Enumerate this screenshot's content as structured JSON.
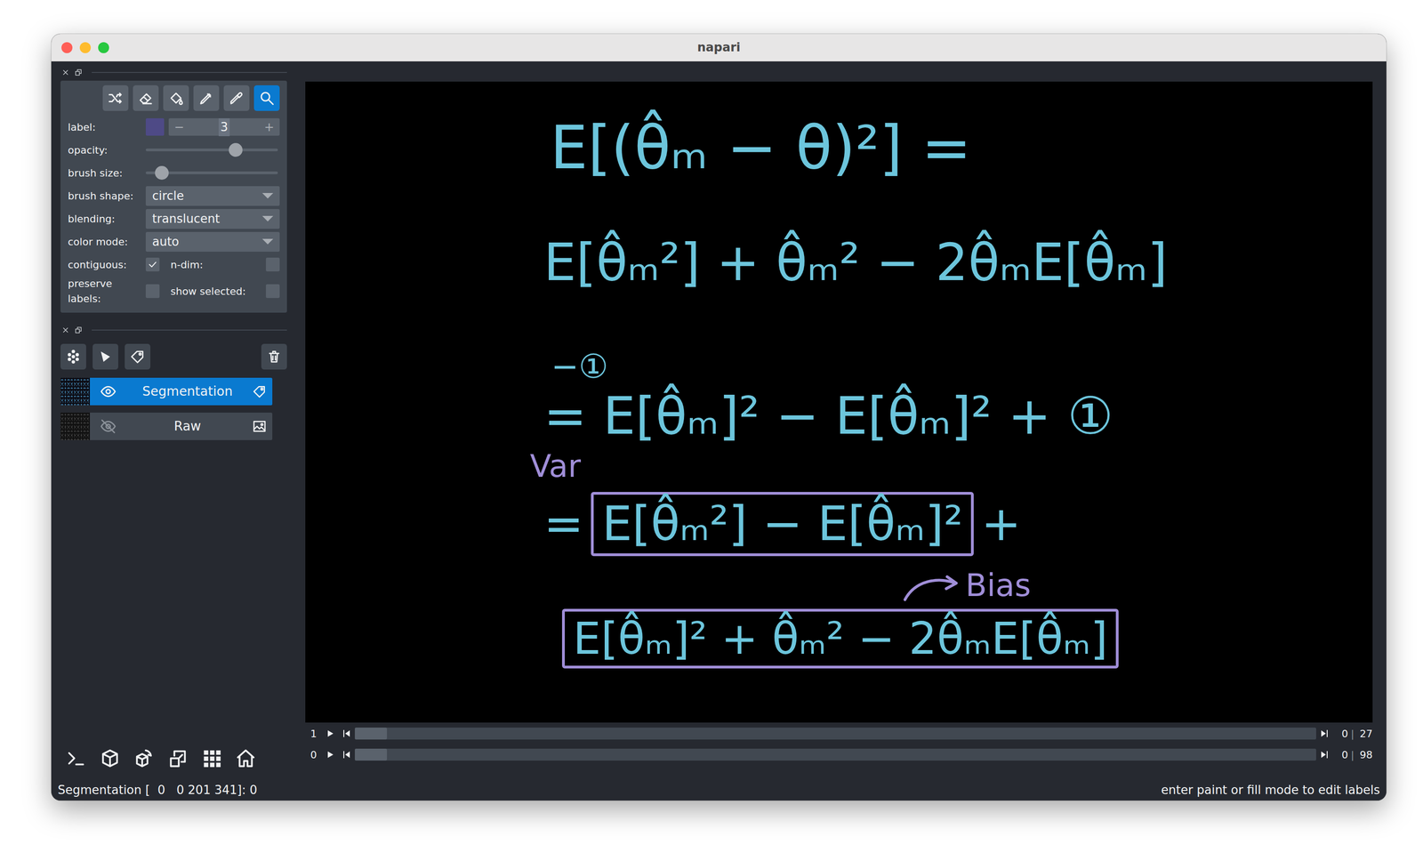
{
  "window": {
    "title": "napari"
  },
  "layer_controls": {
    "tools": [
      {
        "kind": "shuffle",
        "selected": false
      },
      {
        "kind": "erase",
        "selected": false
      },
      {
        "kind": "fill",
        "selected": false
      },
      {
        "kind": "paint",
        "selected": false
      },
      {
        "kind": "pick",
        "selected": false
      },
      {
        "kind": "pan_zoom",
        "selected": true
      }
    ],
    "label": {
      "caption": "label:",
      "value": "3",
      "minus": "−",
      "plus": "+",
      "color": "#4e4a86"
    },
    "sliders": [
      {
        "caption": "opacity:",
        "level": 0.68
      },
      {
        "caption": "brush size:",
        "level": 0.12
      }
    ],
    "dropdowns": [
      {
        "caption": "brush shape:",
        "value": "circle"
      },
      {
        "caption": "blending:",
        "value": "translucent"
      },
      {
        "caption": "color mode:",
        "value": "auto"
      }
    ],
    "checkbox_rows": [
      [
        {
          "caption": "contiguous:",
          "checked": true
        },
        {
          "caption": "n-dim:",
          "checked": false
        }
      ],
      [
        {
          "caption": "preserve labels:",
          "checked": false
        },
        {
          "caption": "show selected:",
          "checked": false
        }
      ]
    ]
  },
  "layer_buttons": [
    {
      "kind": "points"
    },
    {
      "kind": "shapes"
    },
    {
      "kind": "labels"
    },
    {
      "kind": "delete"
    }
  ],
  "layers": [
    {
      "name": "Segmentation",
      "kind": "labels",
      "visible": true,
      "selected": true
    },
    {
      "name": "Raw",
      "kind": "image",
      "visible": false,
      "selected": false
    }
  ],
  "viewer_buttons": [
    {
      "kind": "console"
    },
    {
      "kind": "ndisplay"
    },
    {
      "kind": "roll"
    },
    {
      "kind": "transpose"
    },
    {
      "kind": "grid"
    },
    {
      "kind": "home"
    }
  ],
  "canvas": {
    "items": [
      {
        "kind": "formula",
        "text": "E[(θ̂ₘ − θ)²] =",
        "color": "#6cc5dc"
      },
      {
        "kind": "formula",
        "text": "E[θ̂ₘ²] + θ̂ₘ² − 2θ̂ₘE[θ̂ₘ]",
        "color": "#6cc5dc"
      },
      {
        "kind": "formula",
        "text": "−①",
        "color": "#6cc5dc"
      },
      {
        "kind": "formula",
        "text": "= E[θ̂ₘ]² − E[θ̂ₘ]² + ①",
        "color": "#6cc5dc"
      },
      {
        "kind": "note",
        "text": "Var",
        "color": "#a08ed8"
      },
      {
        "kind": "boxed",
        "lead": "=",
        "text": "E[θ̂ₘ²] − E[θ̂ₘ]²",
        "tail": "+",
        "color": "#6cc5dc",
        "box_color": "#a08ed8"
      },
      {
        "kind": "arrow_note",
        "text": "Bias",
        "color": "#a08ed8"
      },
      {
        "kind": "boxed",
        "text": "E[θ̂ₘ]² + θ̂ₘ² − 2θ̂ₘE[θ̂ₘ]",
        "color": "#6cc5dc",
        "box_color": "#a08ed8"
      }
    ]
  },
  "dims": [
    {
      "label": "1",
      "level": 0,
      "current": "0",
      "separator": "|",
      "max": "27"
    },
    {
      "label": "0",
      "level": 0,
      "current": "0",
      "separator": "|",
      "max": "98"
    }
  ],
  "status_bar": {
    "left": "Segmentation [  0   0 201 341]: 0",
    "right": "enter paint or fill mode to edit labels"
  }
}
